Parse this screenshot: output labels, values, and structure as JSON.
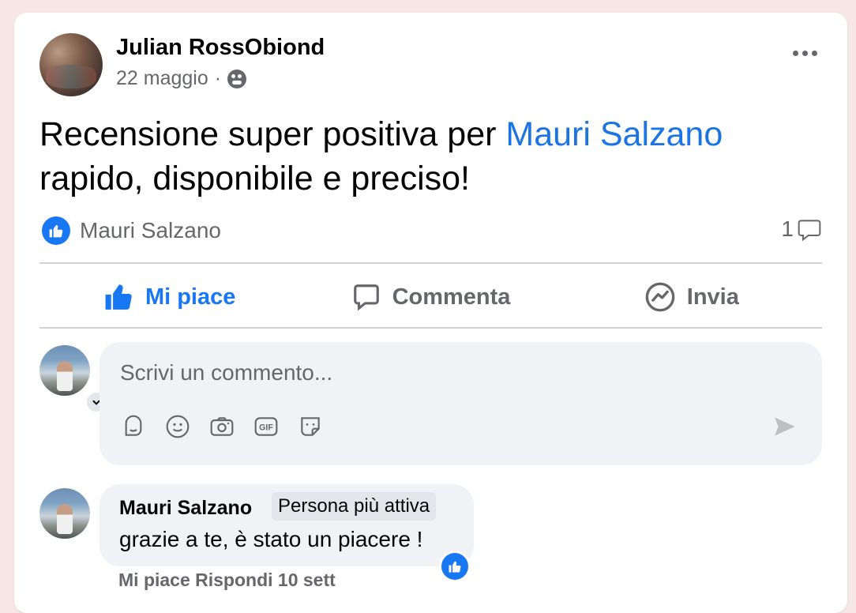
{
  "post": {
    "author": "Julian RossObiond",
    "date": "22 maggio",
    "date_separator": "·",
    "text_prefix": "Recensione super positiva per",
    "mention": "Mauri Salzano",
    "text_suffix": "rapido, disponibile e preciso!"
  },
  "reactions": {
    "liked_by": "Mauri Salzano",
    "comment_count": "1"
  },
  "actions": {
    "like_label": "Mi piace",
    "comment_label": "Comment a",
    "share_label": "Invia"
  },
  "composer": {
    "placeholder": "Scrivi un commento...",
    "tools": [
      "avatar-sticker-icon",
      "emoji-icon",
      "camera-icon",
      "gif-icon",
      "sticker-icon"
    ]
  },
  "reply": {
    "author": "Mauri Salzano",
    "badge": "Persona più attiva",
    "text": "grazie a te, è stato un piacere !",
    "footer": "Mi piace    Rispondi    10 sett"
  },
  "colors": {
    "accent": "#1877f2",
    "mention": "#1b74e4",
    "secondary_text": "#65676b",
    "page_bg": "#f7e7e6"
  }
}
